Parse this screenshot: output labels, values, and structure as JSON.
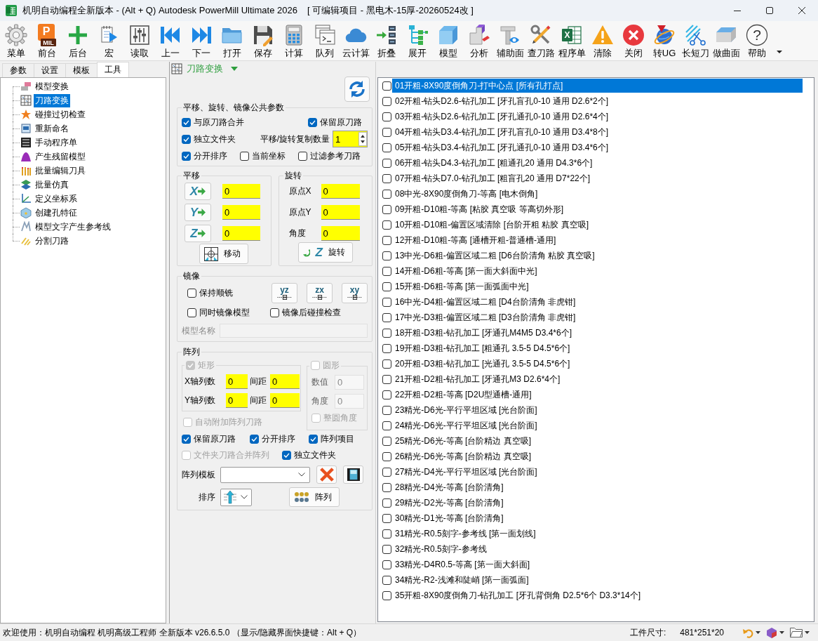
{
  "window": {
    "title": "机明自动编程全新版本 - (Alt + Q) Autodesk PowerMill Ultimate 2026",
    "project": "[ 可编辑项目 - 黑电木-15厚-20260524改 ]"
  },
  "toolbar": [
    {
      "label": "菜单"
    },
    {
      "label": "前台",
      "mark": "P",
      "mark_sub": "MIL"
    },
    {
      "label": "后台"
    },
    {
      "label": "宏"
    },
    {
      "label": "读取"
    },
    {
      "label": "上一"
    },
    {
      "label": "下一"
    },
    {
      "label": "打开"
    },
    {
      "label": "保存"
    },
    {
      "label": "计算"
    },
    {
      "label": "队列"
    },
    {
      "label": "云计算"
    },
    {
      "label": "折叠"
    },
    {
      "label": "展开"
    },
    {
      "label": "模型"
    },
    {
      "label": "分析"
    },
    {
      "label": "辅助面"
    },
    {
      "label": "查刀路"
    },
    {
      "label": "程序单",
      "mark": "X"
    },
    {
      "label": "清除"
    },
    {
      "label": "关闭"
    },
    {
      "label": "转UG"
    },
    {
      "label": "长短刀"
    },
    {
      "label": "做曲面"
    },
    {
      "label": "帮助",
      "mark": "?"
    }
  ],
  "side_tabs": [
    {
      "label": "参数",
      "selected": false
    },
    {
      "label": "设置",
      "selected": false
    },
    {
      "label": "模板",
      "selected": false
    },
    {
      "label": "工具",
      "selected": true
    }
  ],
  "tools": [
    {
      "label": "模型变换",
      "selected": false
    },
    {
      "label": "刀路变换",
      "selected": true
    },
    {
      "label": "碰撞过切检查",
      "selected": false
    },
    {
      "label": "重新命名",
      "selected": false
    },
    {
      "label": "手动程序单",
      "selected": false
    },
    {
      "label": "产生残留模型",
      "selected": false
    },
    {
      "label": "批量编辑刀具",
      "selected": false
    },
    {
      "label": "批量仿真",
      "selected": false
    },
    {
      "label": "定义坐标系",
      "selected": false
    },
    {
      "label": "创建孔特征",
      "selected": false
    },
    {
      "label": "模型文字产生参考线",
      "selected": false
    },
    {
      "label": "分割刀路",
      "selected": false
    }
  ],
  "panel": {
    "title": "刀路变换",
    "common": {
      "legend": "平移、旋转、镜像公共参数",
      "merge": {
        "label": "与原刀路合并",
        "checked": true
      },
      "keep_original": {
        "label": "保留原刀路",
        "checked": true
      },
      "own_folder": {
        "label": "独立文件夹",
        "checked": true
      },
      "copy_count": {
        "label": "平移/旋转复制数量",
        "value": "1"
      },
      "sort_separately": {
        "label": "分开排序",
        "checked": true
      },
      "current_coords": {
        "label": "当前坐标",
        "checked": false
      },
      "filter_reference": {
        "label": "过滤参考刀路",
        "checked": false
      }
    },
    "translate": {
      "legend": "平移",
      "axes": [
        {
          "axis": "X",
          "value": "0"
        },
        {
          "axis": "Y",
          "value": "0"
        },
        {
          "axis": "Z",
          "value": "0"
        }
      ],
      "button": "移动"
    },
    "rotate": {
      "legend": "旋转",
      "fields": [
        {
          "label": "原点X",
          "value": "0"
        },
        {
          "label": "原点Y",
          "value": "0"
        },
        {
          "label": "角度",
          "value": "0"
        }
      ],
      "axis": "Z",
      "button": "旋转"
    },
    "mirror": {
      "legend": "镜像",
      "keep_climb": {
        "label": "保持顺铣",
        "checked": false
      },
      "planes": [
        "yz",
        "zx",
        "xy"
      ],
      "mirror_model": {
        "label": "同时镜像模型",
        "checked": false
      },
      "collision_check": {
        "label": "镜像后碰撞检查",
        "checked": false
      },
      "model_name": {
        "label": "模型名称",
        "disabled": true
      }
    },
    "array": {
      "legend": "阵列",
      "rect": {
        "label": "矩形",
        "checked": true,
        "disabled": true,
        "fields": [
          {
            "label": "X轴列数",
            "value": "0"
          },
          {
            "label": "间距",
            "value": "0"
          },
          {
            "label": "Y轴列数",
            "value": "0"
          },
          {
            "label": "间距",
            "value": "0"
          }
        ]
      },
      "circle": {
        "label": "圆形",
        "checked": false,
        "disabled": true,
        "fields": [
          {
            "label": "数值",
            "value": "0"
          },
          {
            "label": "角度",
            "value": "0"
          }
        ],
        "full_circle": {
          "label": "整圆角度",
          "checked": false,
          "disabled": true
        }
      },
      "auto_append": {
        "label": "自动附加阵列刀路",
        "checked": false,
        "disabled": true
      },
      "options": [
        {
          "label": "保留原刀路",
          "checked": true,
          "disabled": false
        },
        {
          "label": "分开排序",
          "checked": true,
          "disabled": false
        },
        {
          "label": "阵列项目",
          "checked": true,
          "disabled": false
        }
      ],
      "folder_options": [
        {
          "label": "文件夹刀路合并阵列",
          "checked": false,
          "disabled": true
        },
        {
          "label": "独立文件夹",
          "checked": true,
          "disabled": false
        }
      ],
      "template": {
        "label": "阵列模板"
      },
      "sort": {
        "label": "排序"
      },
      "button": "阵列"
    }
  },
  "toolpaths": [
    {
      "label": "01开粗-8X90度倒角刀-打中心点 [所有孔打点]",
      "checked": false,
      "selected": true
    },
    {
      "label": "02开粗-钻头D2.6-钻孔加工 [牙孔盲孔0-10 通用 D2.6*2个]",
      "checked": false,
      "selected": false
    },
    {
      "label": "03开粗-钻头D2.6-钻孔加工 [牙孔通孔0-10 通用 D2.6*4个]",
      "checked": false,
      "selected": false
    },
    {
      "label": "04开粗-钻头D3.4-钻孔加工 [牙孔盲孔0-10 通用 D3.4*8个]",
      "checked": false,
      "selected": false
    },
    {
      "label": "05开粗-钻头D3.4-钻孔加工 [牙孔通孔0-10 通用 D3.4*6个]",
      "checked": false,
      "selected": false
    },
    {
      "label": "06开粗-钻头D4.3-钻孔加工 [粗通孔20 通用 D4.3*6个]",
      "checked": false,
      "selected": false
    },
    {
      "label": "07开粗-钻头D7.0-钻孔加工 [粗盲孔20 通用 D7*22个]",
      "checked": false,
      "selected": false
    },
    {
      "label": "08中光-8X90度倒角刀-等高 [电木倒角]",
      "checked": false,
      "selected": false
    },
    {
      "label": "09开粗-D10粗-等高 [粘胶 真空吸 等高切外形]",
      "checked": false,
      "selected": false
    },
    {
      "label": "10开粗-D10粗-偏置区域清除 [台阶开粗 粘胶 真空吸]",
      "checked": false,
      "selected": false
    },
    {
      "label": "12开粗-D10粗-等高 [通槽开粗-普通槽-通用]",
      "checked": false,
      "selected": false
    },
    {
      "label": "13中光-D6粗-偏置区域二粗 [D6台阶清角 粘胶 真空吸]",
      "checked": false,
      "selected": false
    },
    {
      "label": "14开粗-D6粗-等高 [第一面大斜面中光]",
      "checked": false,
      "selected": false
    },
    {
      "label": "15开粗-D6粗-等高 [第一面弧面中光]",
      "checked": false,
      "selected": false
    },
    {
      "label": "16中光-D4粗-偏置区域二粗 [D4台阶清角 非虎钳]",
      "checked": false,
      "selected": false
    },
    {
      "label": "17中光-D3粗-偏置区域二粗 [D3台阶清角 非虎钳]",
      "checked": false,
      "selected": false
    },
    {
      "label": "18开粗-D3粗-钻孔加工 [牙通孔M4M5 D3.4*6个]",
      "checked": false,
      "selected": false
    },
    {
      "label": "19开粗-D3粗-钻孔加工 [粗通孔 3.5-5 D4.5*6个]",
      "checked": false,
      "selected": false
    },
    {
      "label": "20开粗-D3粗-钻孔加工 [光通孔 3.5-5 D4.5*6个]",
      "checked": false,
      "selected": false
    },
    {
      "label": "21开粗-D2粗-钻孔加工 [牙通孔M3 D2.6*4个]",
      "checked": false,
      "selected": false
    },
    {
      "label": "22开粗-D2粗-等高 [D2U型通槽-通用]",
      "checked": false,
      "selected": false
    },
    {
      "label": "23精光-D6光-平行平坦区域 [光台阶面]",
      "checked": false,
      "selected": false
    },
    {
      "label": "24精光-D6光-平行平坦区域 [光台阶面]",
      "checked": false,
      "selected": false
    },
    {
      "label": "25精光-D6光-等高 [台阶精边 真空吸]",
      "checked": false,
      "selected": false
    },
    {
      "label": "26精光-D6光-等高 [台阶精边 真空吸]",
      "checked": false,
      "selected": false
    },
    {
      "label": "27精光-D4光-平行平坦区域 [光台阶面]",
      "checked": false,
      "selected": false
    },
    {
      "label": "28精光-D4光-等高 [台阶清角]",
      "checked": false,
      "selected": false
    },
    {
      "label": "29精光-D2光-等高 [台阶清角]",
      "checked": false,
      "selected": false
    },
    {
      "label": "30精光-D1光-等高 [台阶清角]",
      "checked": false,
      "selected": false
    },
    {
      "label": "31精光-R0.5刻字-参考线 [第一面划线]",
      "checked": false,
      "selected": false
    },
    {
      "label": "32精光-R0.5刻字-参考线",
      "checked": false,
      "selected": false
    },
    {
      "label": "33精光-D4R0.5-等高 [第一面大斜面]",
      "checked": false,
      "selected": false
    },
    {
      "label": "34精光-R2-浅滩和陡峭 [第一面弧面]",
      "checked": false,
      "selected": false
    },
    {
      "label": "35开粗-8X90度倒角刀-钻孔加工 [牙孔背倒角 D2.5*6个 D3.3*14个]",
      "checked": false,
      "selected": false
    }
  ],
  "status_bar": {
    "message": "欢迎使用：机明自动编程 机明高级工程师 全新版本 v26.6.5.0 （显示/隐藏界面快捷键：Alt + Q）",
    "size_label": "工件尺寸:",
    "size_value": "481*251*20"
  }
}
